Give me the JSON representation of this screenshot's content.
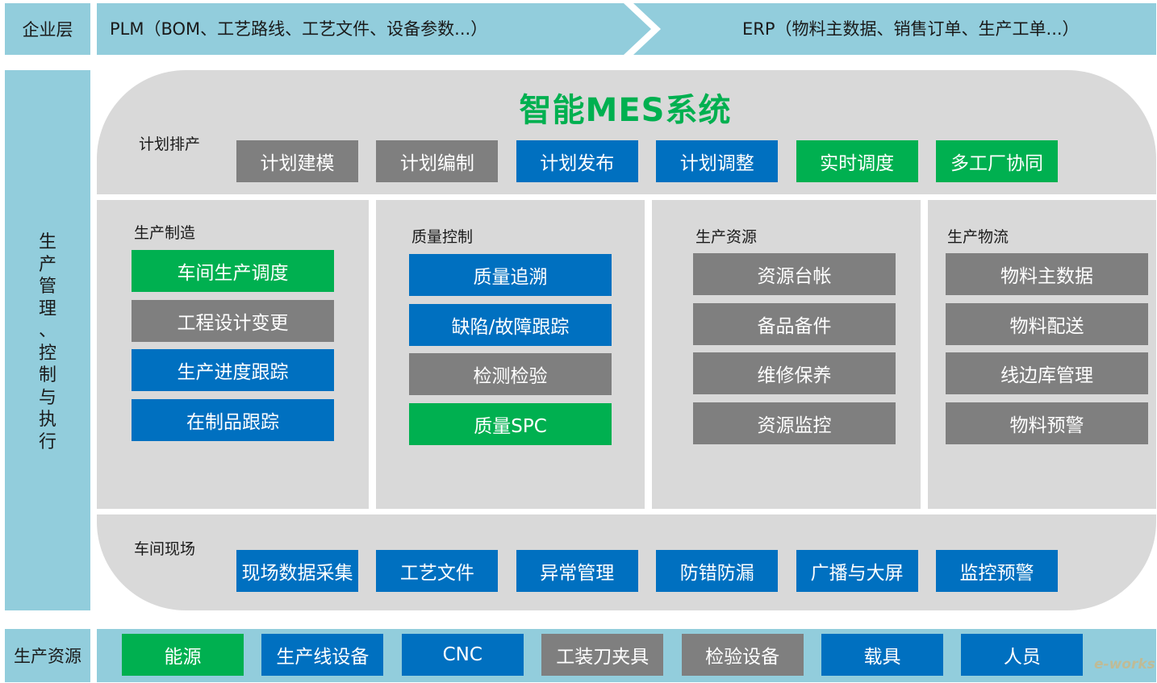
{
  "colors": {
    "band": "#92CDDC",
    "panel": "#D9D9D9",
    "gray": "#7F7F7F",
    "blue": "#0070C0",
    "green": "#00B050",
    "title": "#00B050"
  },
  "enterprise": {
    "label": "企业层",
    "left_text": "PLM（BOM、工艺路线、工艺文件、设备参数...）",
    "right_text": "ERP（物料主数据、销售订单、生产工单...）"
  },
  "side": {
    "label_chars": [
      "生",
      "产",
      "管",
      "理",
      "、",
      "控",
      "制",
      "与",
      "执",
      "行"
    ]
  },
  "mes": {
    "title": "智能MES系统",
    "planning": {
      "label": "计划排产",
      "items": [
        {
          "text": "计划建模",
          "color": "gray"
        },
        {
          "text": "计划编制",
          "color": "gray"
        },
        {
          "text": "计划发布",
          "color": "blue"
        },
        {
          "text": "计划调整",
          "color": "blue"
        },
        {
          "text": "实时调度",
          "color": "green"
        },
        {
          "text": "多工厂协同",
          "color": "green"
        }
      ]
    },
    "columns": [
      {
        "label": "生产制造",
        "items": [
          {
            "text": "车间生产调度",
            "color": "green"
          },
          {
            "text": "工程设计变更",
            "color": "gray"
          },
          {
            "text": "生产进度跟踪",
            "color": "blue"
          },
          {
            "text": "在制品跟踪",
            "color": "blue"
          }
        ]
      },
      {
        "label": "质量控制",
        "items": [
          {
            "text": "质量追溯",
            "color": "blue"
          },
          {
            "text": "缺陷/故障跟踪",
            "color": "blue"
          },
          {
            "text": "检测检验",
            "color": "gray"
          },
          {
            "text": "质量SPC",
            "color": "green"
          }
        ]
      },
      {
        "label": "生产资源",
        "items": [
          {
            "text": "资源台帐",
            "color": "gray"
          },
          {
            "text": "备品备件",
            "color": "gray"
          },
          {
            "text": "维修保养",
            "color": "gray"
          },
          {
            "text": "资源监控",
            "color": "gray"
          }
        ]
      },
      {
        "label": "生产物流",
        "items": [
          {
            "text": "物料主数据",
            "color": "gray"
          },
          {
            "text": "物料配送",
            "color": "gray"
          },
          {
            "text": "线边库管理",
            "color": "gray"
          },
          {
            "text": "物料预警",
            "color": "gray"
          }
        ]
      }
    ],
    "shopfloor": {
      "label": "车间现场",
      "items": [
        {
          "text": "现场数据采集",
          "color": "blue"
        },
        {
          "text": "工艺文件",
          "color": "blue"
        },
        {
          "text": "异常管理",
          "color": "blue"
        },
        {
          "text": "防错防漏",
          "color": "blue"
        },
        {
          "text": "广播与大屏",
          "color": "blue"
        },
        {
          "text": "监控预警",
          "color": "blue"
        }
      ]
    }
  },
  "resources": {
    "label": "生产资源",
    "items": [
      {
        "text": "能源",
        "color": "green"
      },
      {
        "text": "生产线设备",
        "color": "blue"
      },
      {
        "text": "CNC",
        "color": "blue"
      },
      {
        "text": "工装刀夹具",
        "color": "gray"
      },
      {
        "text": "检验设备",
        "color": "gray"
      },
      {
        "text": "载具",
        "color": "blue"
      },
      {
        "text": "人员",
        "color": "blue"
      }
    ]
  },
  "watermark": {
    "text": "e-works"
  }
}
